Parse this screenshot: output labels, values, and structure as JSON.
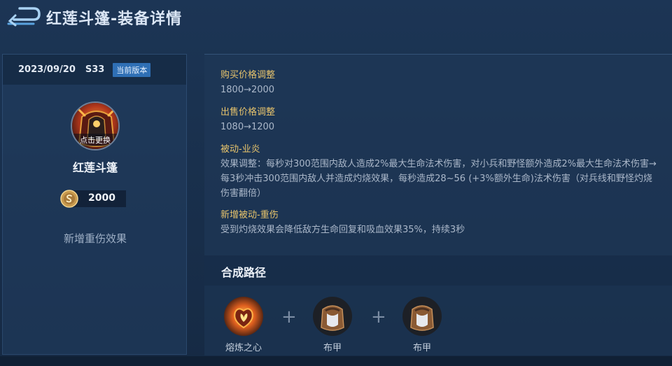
{
  "header": {
    "title": "红莲斗篷-装备详情"
  },
  "left_panel": {
    "date": "2023/09/20",
    "season": "S33",
    "version_badge": "当前版本",
    "avatar_label": "点击更换",
    "item_name": "红莲斗篷",
    "price": "2000",
    "description": "新增重伤效果"
  },
  "changes": [
    {
      "title": "购买价格调整",
      "text": "1800→2000"
    },
    {
      "title": "出售价格调整",
      "text": "1080→1200"
    },
    {
      "title": "被动-业炎",
      "text": "效果调整：每秒对300范围内敌人造成2%最大生命法术伤害，对小兵和野怪额外造成2%最大生命法术伤害→每3秒冲击300范围内敌人并造成灼烧效果，每秒造成28~56 (+3%额外生命)法术伤害（对兵线和野怪灼烧伤害翻倍）"
    },
    {
      "title": "新增被动-重伤",
      "text": "受到灼烧效果会降低敌方生命回复和吸血效果35%，持续3秒"
    }
  ],
  "recipe": {
    "title": "合成路径",
    "items": [
      {
        "name": "熔炼之心",
        "icon": "heart-of-fire-icon"
      },
      {
        "name": "布甲",
        "icon": "cloth-armor-icon"
      },
      {
        "name": "布甲",
        "icon": "cloth-armor-icon"
      }
    ],
    "separator": "+"
  },
  "colors": {
    "accent_gold": "#e6c36c",
    "badge_blue": "#2f6fb5",
    "background": "#1c3555"
  }
}
